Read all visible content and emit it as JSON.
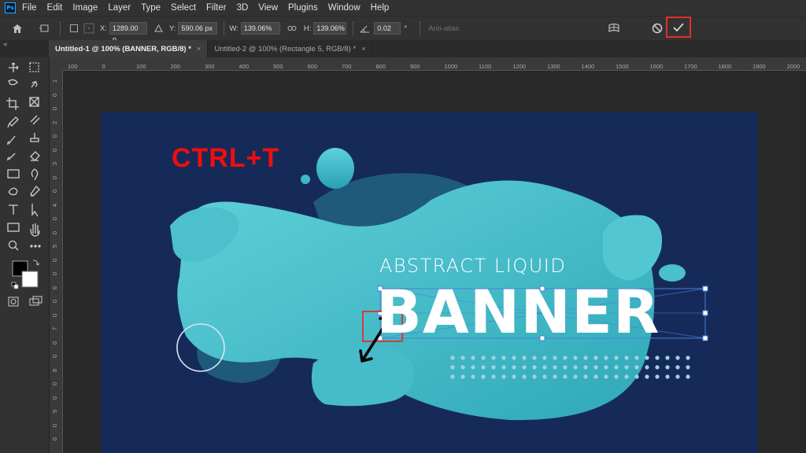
{
  "app": {
    "logo": "Ps"
  },
  "menubar": {
    "items": [
      "File",
      "Edit",
      "Image",
      "Layer",
      "Type",
      "Select",
      "Filter",
      "3D",
      "View",
      "Plugins",
      "Window",
      "Help"
    ]
  },
  "options": {
    "x_label": "X:",
    "x_value": "1289.00 p",
    "y_label": "Y:",
    "y_value": "590.06 px",
    "w_label": "W:",
    "w_value": "139.06%",
    "h_label": "H:",
    "h_value": "139.06%",
    "angle_value": "0.02",
    "angle_unit": "°",
    "antialias_label": "Anti-alias"
  },
  "tabs": [
    {
      "label": "Untitled-1 @ 100% (BANNER, RGB/8) *",
      "close": "×"
    },
    {
      "label": "Untitled-2 @ 100% (Rectangle 5, RGB/8) *",
      "close": "×"
    }
  ],
  "ruler_h": [
    "100",
    "0",
    "100",
    "200",
    "300",
    "400",
    "500",
    "600",
    "700",
    "800",
    "900",
    "1000",
    "1100",
    "1200",
    "1300",
    "1400",
    "1500",
    "1600",
    "1700",
    "1800",
    "1900",
    "2000"
  ],
  "ruler_v": [
    "1",
    "0",
    "0",
    "2",
    "0",
    "0",
    "3",
    "0",
    "0",
    "4",
    "0",
    "0",
    "5",
    "0",
    "0",
    "6",
    "0",
    "0",
    "7",
    "0",
    "0",
    "8",
    "0",
    "0",
    "9",
    "0",
    "0"
  ],
  "canvas": {
    "shortcut": "CTRL+T",
    "subtitle": "ABSTRACT LIQUID",
    "title": "BANNER"
  },
  "colors": {
    "accent_red": "#e0302e",
    "canvas_bg": "#162a5a",
    "blob": "#4cc3cf"
  },
  "panel_toggle": "«"
}
